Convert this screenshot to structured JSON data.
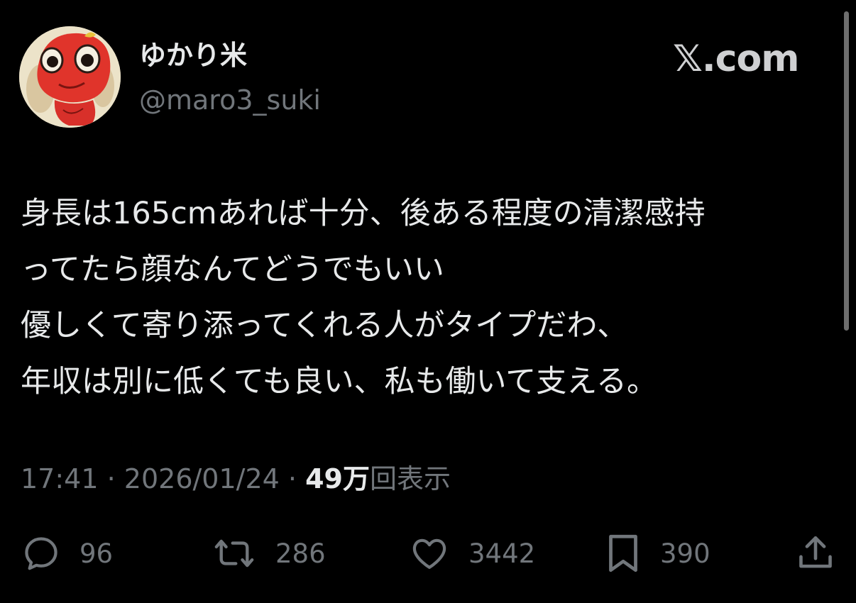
{
  "header": {
    "display_name": "ゆかり米",
    "handle": "@maro3_suki",
    "brand": "𝕏.com",
    "avatar_icon": "cartoon-character-avatar"
  },
  "tweet": {
    "lines": [
      "身長は165cmあれば十分、後ある程度の清潔感持",
      "ってたら顔なんてどうでもいい",
      "優しくて寄り添ってくれる人がタイプだわ、",
      "年収は別に低くても良い、私も働いて支える。"
    ]
  },
  "meta": {
    "time": "17:41",
    "separator": "·",
    "date": "2026/01/24",
    "views_count": "49万",
    "views_label": "回表示"
  },
  "actions": {
    "reply": {
      "icon": "reply-icon",
      "count": "96"
    },
    "repost": {
      "icon": "repost-icon",
      "count": "286"
    },
    "like": {
      "icon": "heart-icon",
      "count": "3442"
    },
    "bookmark": {
      "icon": "bookmark-icon",
      "count": "390"
    },
    "share": {
      "icon": "share-icon"
    }
  },
  "colors": {
    "background": "#000000",
    "primary_text": "#e7e9ea",
    "secondary_text": "#71767b"
  }
}
